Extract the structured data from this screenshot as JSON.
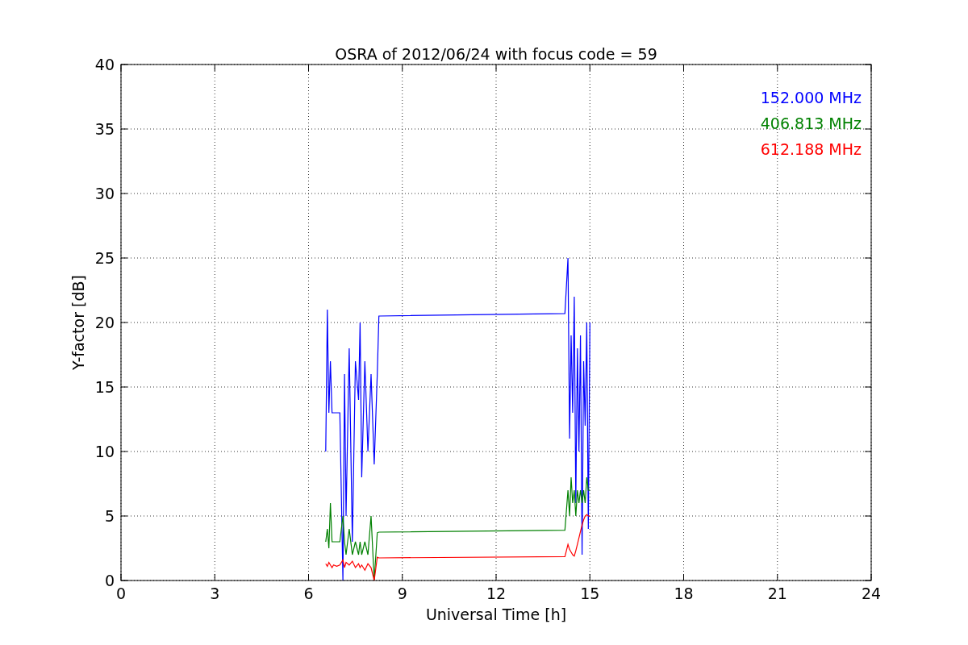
{
  "chart_data": {
    "type": "line",
    "title": "OSRA of 2012/06/24 with focus code = 59",
    "xlabel": "Universal Time [h]",
    "ylabel": "Y-factor [dB]",
    "x": [
      6.55,
      6.6,
      6.65,
      6.7,
      6.75,
      6.8,
      6.9,
      7.0,
      7.1,
      7.15,
      7.2,
      7.3,
      7.4,
      7.5,
      7.6,
      7.65,
      7.7,
      7.8,
      7.9,
      8.0,
      8.1,
      8.2,
      8.25,
      14.2,
      14.3,
      14.35,
      14.4,
      14.45,
      14.5,
      14.55,
      14.6,
      14.65,
      14.7,
      14.75,
      14.8,
      14.85,
      14.9,
      14.95,
      15.0
    ],
    "series": [
      {
        "name": "152.000 MHz",
        "color": "#0000ff",
        "values": [
          10,
          21,
          13,
          17,
          13,
          13,
          13,
          13,
          0,
          16,
          5,
          18,
          3,
          17,
          14,
          20,
          8,
          17,
          10,
          16,
          9,
          16,
          20.5,
          20.7,
          25,
          11,
          19,
          13,
          22,
          6,
          18,
          10,
          19,
          2,
          17,
          12,
          20,
          4,
          20
        ]
      },
      {
        "name": "406.813 MHz",
        "color": "#008000",
        "values": [
          3,
          4,
          2.5,
          6,
          3,
          3,
          3,
          3,
          5,
          3,
          2,
          4,
          2,
          3,
          2,
          3,
          2,
          3,
          2,
          5,
          0,
          3.7,
          3.75,
          3.9,
          7,
          5,
          8,
          6,
          7,
          5,
          7,
          6,
          7,
          6,
          7,
          6,
          8,
          7,
          7
        ]
      },
      {
        "name": "612.188 MHz",
        "color": "#ff0000",
        "values": [
          1.3,
          1.1,
          1.4,
          1.2,
          1,
          1.2,
          1.1,
          1.2,
          1.6,
          1,
          1.4,
          1.2,
          1.5,
          1,
          1.3,
          1,
          1.2,
          0.8,
          1.3,
          1,
          0,
          1.8,
          1.75,
          1.85,
          2.8,
          2.4,
          2.2,
          2,
          1.9,
          2.3,
          2.8,
          3.3,
          3.8,
          4.3,
          4.7,
          5,
          5.1,
          5.0,
          5.0
        ]
      }
    ],
    "grid": true,
    "xlim": [
      0,
      24
    ],
    "ylim": [
      0,
      40
    ],
    "xticks": [
      0,
      3,
      6,
      9,
      12,
      15,
      18,
      21,
      24
    ],
    "yticks": [
      0,
      5,
      10,
      15,
      20,
      25,
      30,
      35,
      40
    ]
  }
}
